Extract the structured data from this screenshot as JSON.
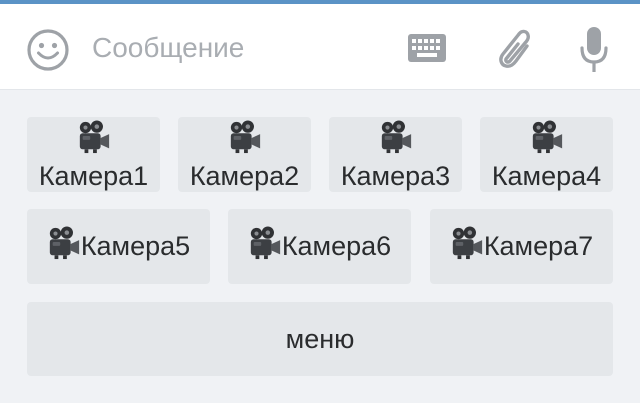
{
  "composer": {
    "placeholder": "Сообщение",
    "icons": [
      "emoji-icon",
      "keyboard-icon",
      "paperclip-icon",
      "microphone-icon"
    ]
  },
  "keyboard": {
    "button_icon": "movie-camera-icon",
    "row1": [
      "Камера1",
      "Камера2",
      "Камера3",
      "Камера4"
    ],
    "row2": [
      "Камера5",
      "Камера6",
      "Камера7"
    ],
    "row3": [
      "меню"
    ]
  },
  "colors": {
    "accent": "#5b93c6",
    "button_bg": "#e4e7ea",
    "icon_gray": "#9ea2a7"
  }
}
